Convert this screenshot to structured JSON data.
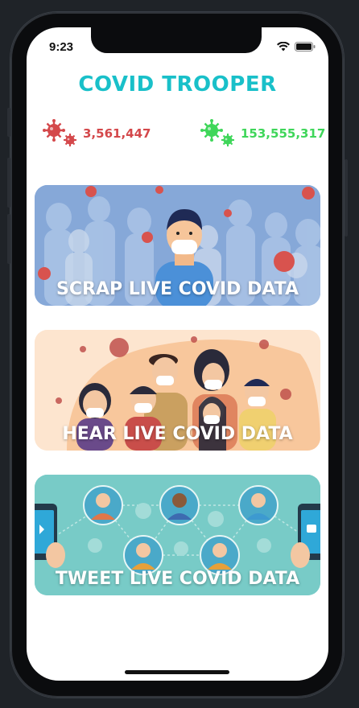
{
  "status_bar": {
    "time": "9:23"
  },
  "app": {
    "title": "COVID TROOPER"
  },
  "stats": {
    "deaths": {
      "value": "3,561,447",
      "color": "#d4484b",
      "icon": "virus-icon"
    },
    "recovered": {
      "value": "153,555,317",
      "color": "#3fd65a",
      "icon": "virus-icon"
    }
  },
  "cards": [
    {
      "label": "SCRAP LIVE COVID DATA",
      "theme": "#7ea2d6"
    },
    {
      "label": "HEAR  LIVE COVID DATA",
      "theme": "#f6cda8"
    },
    {
      "label": "TWEET LIVE COVID DATA",
      "theme": "#72c7c3"
    }
  ],
  "colors": {
    "accent": "#19c0c9"
  }
}
